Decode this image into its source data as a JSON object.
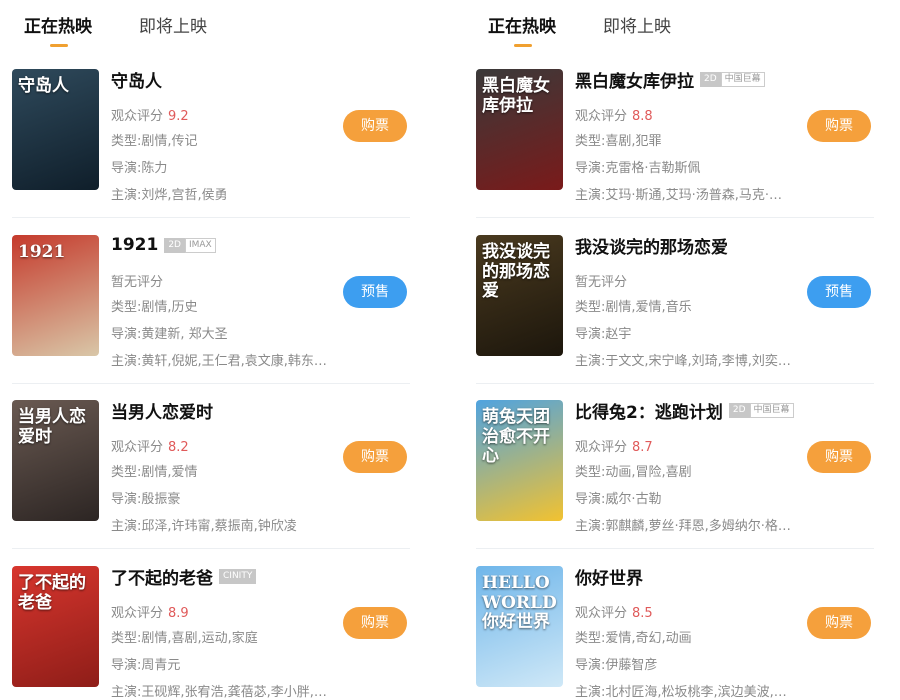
{
  "colors": {
    "accent": "#f0a030",
    "buy": "#f5a03c",
    "presale": "#3d9ef0",
    "score": "#e05a5a"
  },
  "left": {
    "tabs": [
      "正在热映",
      "即将上映"
    ],
    "movies": [
      {
        "title": "守岛人",
        "badges": [],
        "score_label": "观众评分",
        "score": "9.2",
        "type": "类型:剧情,传记",
        "director": "导演:陈力",
        "cast": "主演:刘烨,宫哲,侯勇",
        "button": "购票",
        "button_kind": "buy",
        "poster_text": "守岛人",
        "poster_colors": [
          "#2f4a5c",
          "#0f1e2a"
        ]
      },
      {
        "title": "1921",
        "badges": [
          {
            "text": "2D",
            "dark": true
          },
          {
            "text": "IMAX",
            "dark": false
          }
        ],
        "score_label": "暂无评分",
        "score": "",
        "type": "类型:剧情,历史",
        "director": "导演:黄建新, 郑大圣",
        "cast": "主演:黄轩,倪妮,王仁君,袁文康,韩东君,...",
        "button": "预售",
        "button_kind": "pre",
        "poster_text": "1921",
        "poster_colors": [
          "#c53a2c",
          "#d9c7a8"
        ]
      },
      {
        "title": "当男人恋爱时",
        "badges": [],
        "score_label": "观众评分",
        "score": "8.2",
        "type": "类型:剧情,爱情",
        "director": "导演:殷振豪",
        "cast": "主演:邱泽,许玮甯,蔡振南,钟欣凌",
        "button": "购票",
        "button_kind": "buy",
        "poster_text": "当男人恋爱时",
        "poster_colors": [
          "#6a5a52",
          "#2c2523"
        ]
      },
      {
        "title": "了不起的老爸",
        "badges": [
          {
            "text": "CINITY",
            "dark": true
          }
        ],
        "score_label": "观众评分",
        "score": "8.9",
        "type": "类型:剧情,喜剧,运动,家庭",
        "director": "导演:周青元",
        "cast": "主演:王砚辉,张宥浩,龚蓓苾,李小胖,鹤...",
        "button": "购票",
        "button_kind": "buy",
        "poster_text": "了不起的老爸",
        "poster_colors": [
          "#d8362e",
          "#8e1d18"
        ]
      }
    ]
  },
  "right": {
    "tabs": [
      "正在热映",
      "即将上映"
    ],
    "movies": [
      {
        "title": "黑白魔女库伊拉",
        "badges": [
          {
            "text": "2D",
            "dark": true
          },
          {
            "text": "中国巨幕",
            "dark": false
          }
        ],
        "score_label": "观众评分",
        "score": "8.8",
        "type": "类型:喜剧,犯罪",
        "director": "导演:克雷格·吉勒斯佩",
        "cast": "主演:艾玛·斯通,艾玛·汤普森,马克·斯...",
        "button": "购票",
        "button_kind": "buy",
        "poster_text": "黑白魔女库伊拉",
        "poster_colors": [
          "#3a3a3a",
          "#7a1a1a"
        ]
      },
      {
        "title": "我没谈完的那场恋爱",
        "badges": [],
        "score_label": "暂无评分",
        "score": "",
        "type": "类型:剧情,爱情,音乐",
        "director": "导演:赵宇",
        "cast": "主演:于文文,宋宁峰,刘琦,李博,刘奕,尹...",
        "button": "预售",
        "button_kind": "pre",
        "poster_text": "我没谈完的那场恋爱",
        "poster_colors": [
          "#4a3a1f",
          "#1c160c"
        ]
      },
      {
        "title": "比得兔2：逃跑计划",
        "badges": [
          {
            "text": "2D",
            "dark": true
          },
          {
            "text": "中国巨幕",
            "dark": false
          }
        ],
        "score_label": "观众评分",
        "score": "8.7",
        "type": "类型:动画,冒险,喜剧",
        "director": "导演:威尔·古勒",
        "cast": "主演:郭麒麟,萝丝·拜恩,多姆纳尔·格里...",
        "button": "购票",
        "button_kind": "buy",
        "poster_text": "萌兔天团 治愈不开心",
        "poster_colors": [
          "#4fa3e0",
          "#f2c230"
        ]
      },
      {
        "title": "你好世界",
        "badges": [],
        "score_label": "观众评分",
        "score": "8.5",
        "type": "类型:爱情,奇幻,动画",
        "director": "导演:伊藤智彦",
        "cast": "主演:北村匠海,松坂桃李,滨边美波,子...",
        "button": "购票",
        "button_kind": "buy",
        "poster_text": "HELLO WORLD 你好世界",
        "poster_colors": [
          "#6fb6ea",
          "#cfe8f7"
        ]
      }
    ]
  }
}
